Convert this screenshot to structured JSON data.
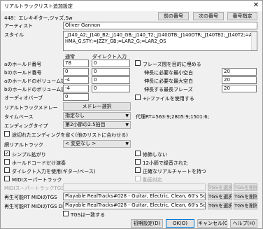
{
  "window": {
    "title": "リアルトラックリスト追加設定",
    "close_glyph": "✕"
  },
  "header": {
    "song_info": "448：エレキギター,ジャズ,Sw",
    "prev_button": "前の番号",
    "next_button": "次の番号",
    "specify_button": "番号指定"
  },
  "artist": {
    "label": "アーティスト",
    "value": "Oliver Gannon"
  },
  "style": {
    "label": "スタイル",
    "value": "_J140_A2;_J140_B2;_J140_GB;_J140_T2;_J140OTB;_J140OTR;_J140TB2;_J140T2;=AHMA_G,STY;=JZZY_GB;=LAR2_G;=LAR2_OS"
  },
  "columns": {
    "normal": "通常",
    "direct": "ダイレクト入力"
  },
  "left_rows": [
    {
      "label": "aのホールド番号",
      "normal": "78",
      "direct": "0"
    },
    {
      "label": "bのホールド番号",
      "normal": "0",
      "direct": "0"
    },
    {
      "label": "aのホールドのボリューム調整",
      "normal": "-4",
      "direct": "0"
    },
    {
      "label": "bのホールドのボリューム調整",
      "normal": "-4",
      "direct": "0"
    },
    {
      "label": "オーディオバーブ",
      "normal": "0",
      "direct": ""
    }
  ],
  "right_panel": {
    "phrase_check": "フレーズ間を目的に埋める",
    "rows": [
      {
        "label": "伸長に必要な最小空白",
        "value": "20"
      },
      {
        "label": "伸長に必要な最大空白",
        "value": "20"
      },
      {
        "label": "伸長する最長フレーズ",
        "value": "20"
      }
    ],
    "plusminus_check": "+/-ファイルを使用する"
  },
  "rt_fields": {
    "medley_label": "リアルトラックメドレー",
    "medley_button": "メドレー選択",
    "timebase_label": "タイムベース",
    "timebase_value": "指定なし",
    "ending_label": "エンディングタイプ",
    "ending_value": "第2小節の2.5拍目",
    "proxy_text": "代理RT=563:9;2805:9;1501:6;"
  },
  "checks": [
    {
      "label": "途切れたエンディングを省く(他のリストに合わせる)",
      "checked": false
    },
    {
      "label": "シンプル拡がり",
      "checked": true
    },
    {
      "label": "ホールドコードだけ演奏",
      "checked": false
    },
    {
      "label": "ダイレクト入力を使用(ギター/ベース)",
      "checked": false
    },
    {
      "label": "MIDIスーパートラック",
      "checked": false
    }
  ],
  "right_checks": [
    {
      "label": "修飾しない",
      "checked": false
    },
    {
      "label": "12小節で録音された",
      "checked": false
    },
    {
      "label": "正確なリアルチャートを持つ",
      "checked": false
    },
    {
      "label": "動画対応",
      "checked": false
    }
  ],
  "track_alias": {
    "label": "網リアルトラック",
    "value": "< 変更なし >"
  },
  "midi_tgs": {
    "label": "MIDIスーパートラックTGS",
    "value": "",
    "btn1": "TGSを選択",
    "btn2": "TGSを削除"
  },
  "rt_midi1": {
    "label": "再生可能RT MIDIのTGS",
    "value": "Playable RealTracks#028 - Guitar, Electric, Clean, 60's Soul Funk [SN07",
    "btn1": "TGSを選択",
    "btn2": "TGSを削除"
  },
  "rt_midi2": {
    "label": "再生可能RT MIDIのTGS DI",
    "value": "Playable RealTracks#028 - Guitar, Electric, Clean, 60's Soul Funk [SN07",
    "btn1": "TGSを選択",
    "btn2": "TGSを削除"
  },
  "tgs_match": {
    "label": "TGSは一致する",
    "checked": false
  },
  "footer": {
    "reset": "初期設定(D)",
    "ok": "OK(O)",
    "cancel": "キャンセル(C)",
    "help": "ヘルプ(H)"
  }
}
